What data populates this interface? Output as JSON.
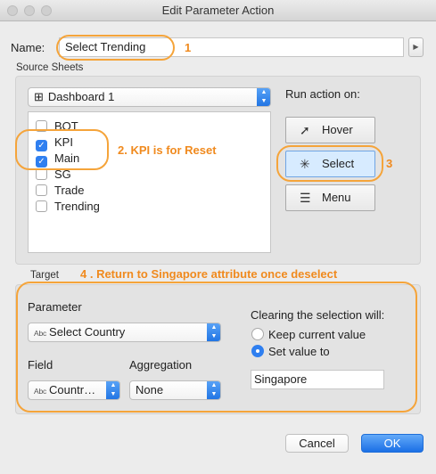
{
  "window": {
    "title": "Edit Parameter Action"
  },
  "name": {
    "label": "Name:",
    "value": "Select Trending"
  },
  "source_sheets": {
    "label": "Source Sheets",
    "dashboard": "Dashboard 1",
    "sheets": [
      {
        "label": "BOT",
        "checked": false
      },
      {
        "label": "KPI",
        "checked": true
      },
      {
        "label": "Main",
        "checked": true
      },
      {
        "label": "SG",
        "checked": false
      },
      {
        "label": "Trade",
        "checked": false
      },
      {
        "label": "Trending",
        "checked": false
      }
    ]
  },
  "run_action": {
    "label": "Run action on:",
    "options": [
      {
        "label": "Hover",
        "icon": "pointer-icon"
      },
      {
        "label": "Select",
        "icon": "select-click-icon",
        "selected": true
      },
      {
        "label": "Menu",
        "icon": "menu-icon"
      }
    ]
  },
  "target": {
    "label": "Target",
    "parameter_label": "Parameter",
    "parameter_value": "Select Country",
    "field_label": "Field",
    "field_value": "Countr…",
    "aggregation_label": "Aggregation",
    "aggregation_value": "None",
    "clearing_label": "Clearing the selection will:",
    "keep_label": "Keep current value",
    "set_label": "Set value to",
    "set_value": "Singapore",
    "type_badge": "Abc"
  },
  "buttons": {
    "cancel": "Cancel",
    "ok": "OK"
  },
  "annotations": {
    "n1": "1",
    "n2": "2. KPI is for Reset",
    "n3": "3",
    "n4": "4 . Return to Singapore attribute once deselect"
  },
  "colors": {
    "accent": "#2f7ff0",
    "annotation": "#f5a43a"
  }
}
